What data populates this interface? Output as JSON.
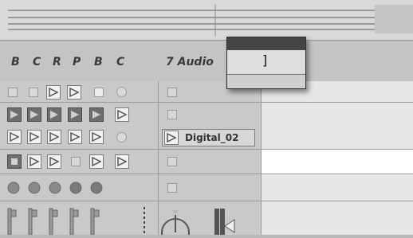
{
  "header": {
    "columns": [
      "B",
      "C",
      "R",
      "P",
      "B",
      "C"
    ],
    "track_name": "7 Audio"
  },
  "grid": {
    "clip_name": "Digital_02"
  },
  "popup": {
    "value": "]"
  },
  "icons": {
    "play": "play-triangle-icon",
    "stop": "stop-square-icon",
    "record": "circle-icon",
    "pan": "pan-knob-icon",
    "meter": "meter-icon"
  },
  "colors": {
    "background": "#c9c9c9",
    "dark_button": "#6e6e6e",
    "popup_bar": "#454545"
  }
}
